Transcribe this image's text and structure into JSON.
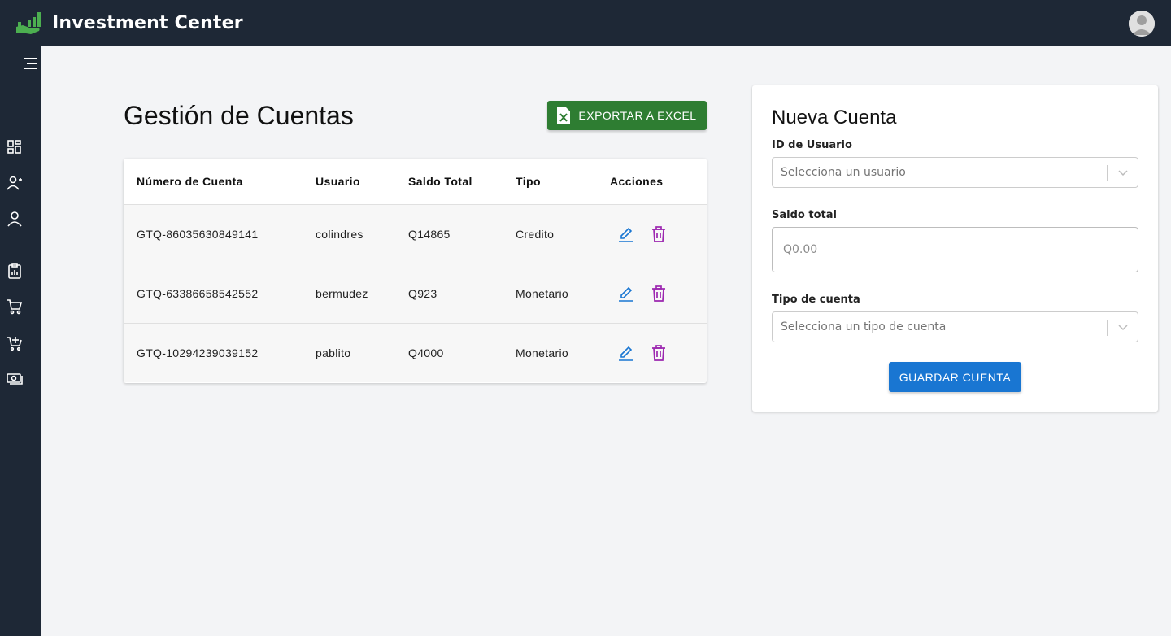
{
  "app": {
    "title": "Investment Center"
  },
  "colors": {
    "topbar": "#1e2836",
    "export_green": "#2e7d32",
    "primary_blue": "#1976d2",
    "edit_blue": "#1976d2",
    "delete_purple": "#9c27b0"
  },
  "sidebar": {
    "items": [
      {
        "icon": "menu-icon"
      },
      {
        "icon": "dashboard-icon"
      },
      {
        "icon": "add-user-icon"
      },
      {
        "icon": "user-icon"
      },
      {
        "icon": "clipboard-report-icon"
      },
      {
        "icon": "shopping-cart-icon"
      },
      {
        "icon": "add-cart-icon"
      },
      {
        "icon": "money-icon"
      }
    ]
  },
  "main": {
    "title": "Gestión de Cuentas",
    "export_label": "EXPORTAR A EXCEL",
    "table": {
      "headers": [
        "Número de Cuenta",
        "Usuario",
        "Saldo Total",
        "Tipo",
        "Acciones"
      ],
      "rows": [
        {
          "cuenta": "GTQ-86035630849141",
          "usuario": "colindres",
          "saldo": "Q14865",
          "tipo": "Credito"
        },
        {
          "cuenta": "GTQ-63386658542552",
          "usuario": "bermudez",
          "saldo": "Q923",
          "tipo": "Monetario"
        },
        {
          "cuenta": "GTQ-10294239039152",
          "usuario": "pablito",
          "saldo": "Q4000",
          "tipo": "Monetario"
        }
      ]
    }
  },
  "form": {
    "title": "Nueva Cuenta",
    "user_label": "ID de Usuario",
    "user_placeholder": "Selecciona un usuario",
    "balance_label": "Saldo total",
    "balance_placeholder": "Q0.00",
    "type_label": "Tipo de cuenta",
    "type_placeholder": "Selecciona un tipo de cuenta",
    "save_label": "GUARDAR CUENTA"
  }
}
